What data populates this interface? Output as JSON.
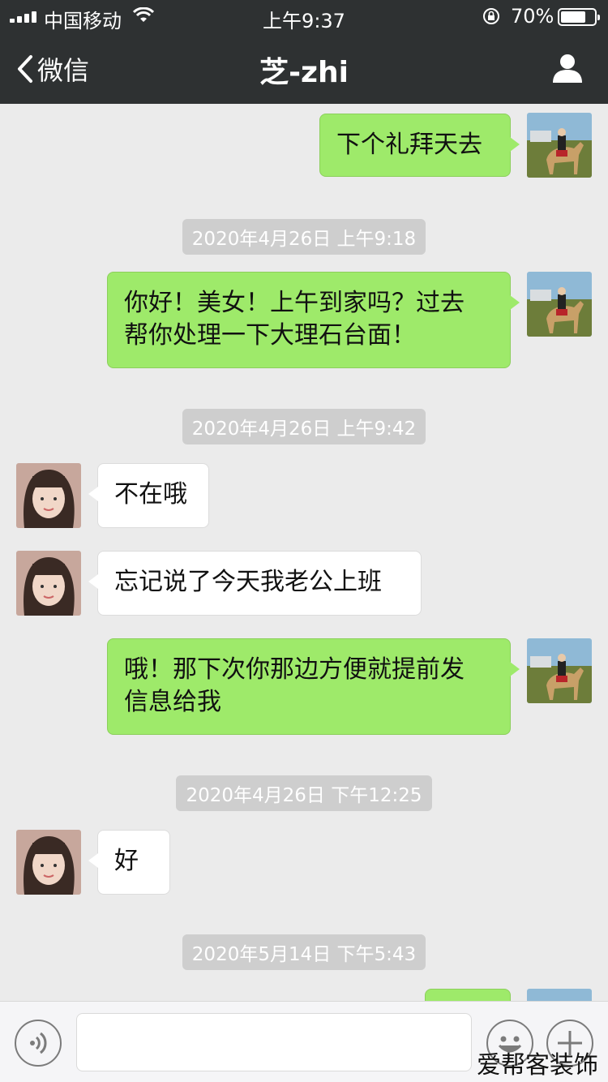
{
  "status_bar": {
    "carrier": "中国移动",
    "time": "上午9:37",
    "battery_percent": "70%",
    "battery_level": 0.7
  },
  "nav": {
    "back_label": "微信",
    "title": "芝-zhi"
  },
  "messages": [
    {
      "from": "me",
      "text": "下个礼拜天去"
    },
    {
      "type": "timestamp",
      "text": "2020年4月26日 上午9:18"
    },
    {
      "from": "me",
      "lines": [
        "你好！美女！上午到家吗？过去",
        "帮你处理一下大理石台面！"
      ]
    },
    {
      "type": "timestamp",
      "text": "2020年4月26日 上午9:42"
    },
    {
      "from": "them",
      "text": "不在哦"
    },
    {
      "from": "them",
      "text": "忘记说了今天我老公上班"
    },
    {
      "from": "me",
      "lines": [
        "哦！那下次你那边方便就提前发",
        "信息给我"
      ]
    },
    {
      "type": "timestamp",
      "text": "2020年4月26日 下午12:25"
    },
    {
      "from": "them",
      "text": "好"
    },
    {
      "type": "timestamp",
      "text": "2020年5月14日 下午5:43"
    },
    {
      "from": "me",
      "text": ""
    }
  ],
  "input_bar": {
    "voice_icon": "voice-icon",
    "emoji_icon": "emoji-icon",
    "plus_icon": "plus-icon"
  },
  "watermark": "爱帮客装饰",
  "colors": {
    "header_bg": "#2e3132",
    "chat_bg": "#ebebeb",
    "my_bubble": "#9eea6a",
    "their_bubble": "#ffffff",
    "timestamp_bg": "#cecece"
  }
}
